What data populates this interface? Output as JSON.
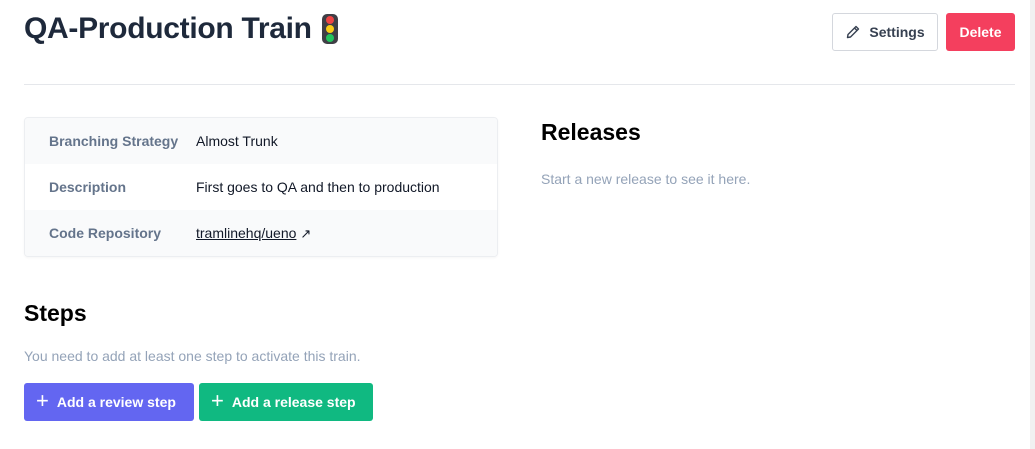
{
  "header": {
    "title": "QA-Production Train",
    "title_icon": "traffic-light-icon",
    "settings_label": "Settings",
    "delete_label": "Delete"
  },
  "details": {
    "rows": [
      {
        "label": "Branching Strategy",
        "value": "Almost Trunk"
      },
      {
        "label": "Description",
        "value": "First goes to QA and then to production"
      },
      {
        "label": "Code Repository",
        "value": "tramlinehq/ueno"
      }
    ],
    "external_link_icon": "↗"
  },
  "releases": {
    "title": "Releases",
    "empty_text": "Start a new release to see it here."
  },
  "steps": {
    "title": "Steps",
    "empty_text": "You need to add at least one step to activate this train.",
    "add_review_label": "Add a review step",
    "add_release_label": "Add a release step"
  },
  "colors": {
    "delete": "#f43f5e",
    "review_button": "#6366f1",
    "release_button": "#10b981",
    "traffic_red": "#ef4444",
    "traffic_yellow": "#facc15",
    "traffic_green": "#22c55e"
  }
}
